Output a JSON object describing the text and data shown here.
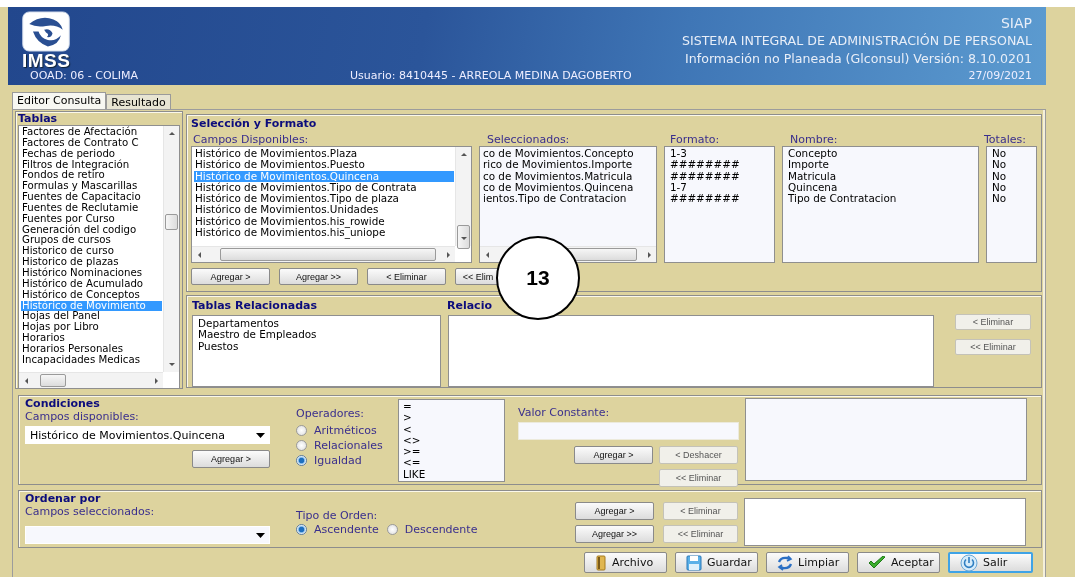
{
  "header": {
    "logo_text": "IMSS",
    "ooad": "OOAD: 06 - COLIMA",
    "user": "Usuario:  8410445 - ARREOLA MEDINA DAGOBERTO",
    "app": "SIAP",
    "system": "SISTEMA INTEGRAL DE ADMINISTRACIÓN DE PERSONAL",
    "info": "Información no Planeada (Glconsul) Versión: 8.10.0201",
    "date": "27/09/2021"
  },
  "tabs": [
    {
      "label": "Editor Consulta",
      "selected": true
    },
    {
      "label": "Resultado",
      "selected": false
    }
  ],
  "tablas": {
    "title": "Tablas",
    "items": [
      {
        "label": "Factores de Afectación",
        "selected": false
      },
      {
        "label": "Factores de Contrato C",
        "selected": false
      },
      {
        "label": "Fechas de periodo",
        "selected": false
      },
      {
        "label": "Filtros de Integración",
        "selected": false
      },
      {
        "label": "Fondos de retiro",
        "selected": false
      },
      {
        "label": "Formulas y Mascarillas",
        "selected": false
      },
      {
        "label": "Fuentes de Capacitacio",
        "selected": false
      },
      {
        "label": "Fuentes de Reclutamie",
        "selected": false
      },
      {
        "label": "Fuentes por Curso",
        "selected": false
      },
      {
        "label": "Generación del codigo",
        "selected": false
      },
      {
        "label": "Grupos de cursos",
        "selected": false
      },
      {
        "label": "Historico de curso",
        "selected": false
      },
      {
        "label": "Historico de plazas",
        "selected": false
      },
      {
        "label": "Histórico Nominaciones",
        "selected": false
      },
      {
        "label": "Histórico de Acumulado",
        "selected": false
      },
      {
        "label": "Histórico de Conceptos",
        "selected": false
      },
      {
        "label": "Histórico de Movimiento",
        "selected": true
      },
      {
        "label": "Hojas del Panel",
        "selected": false
      },
      {
        "label": "Hojas por Libro",
        "selected": false
      },
      {
        "label": "Horarios",
        "selected": false
      },
      {
        "label": "Horarios Personales",
        "selected": false
      },
      {
        "label": "Incapacidades Medicas",
        "selected": false
      }
    ]
  },
  "seleccion": {
    "title": "Selección y Formato",
    "campos": {
      "label": "Campos Disponibles:",
      "items": [
        {
          "label": "Histórico de Movimientos.Plaza",
          "selected": false
        },
        {
          "label": "Histórico de Movimientos.Puesto",
          "selected": false
        },
        {
          "label": "Histórico de Movimientos.Quincena",
          "selected": true
        },
        {
          "label": "Histórico de Movimientos.Tipo de Contrata",
          "selected": false
        },
        {
          "label": "Histórico de Movimientos.Tipo de plaza",
          "selected": false
        },
        {
          "label": "Histórico de Movimientos.Unidades",
          "selected": false
        },
        {
          "label": "Histórico de Movimientos.his_rowide",
          "selected": false
        },
        {
          "label": "Histórico de Movimientos.his_uniope",
          "selected": false
        }
      ]
    },
    "seleccionados": {
      "label": "Seleccionados:",
      "items": [
        "co de Movimientos.Concepto",
        "rico de Movimientos.Importe",
        "co de Movimientos.Matricula",
        "co de Movimientos.Quincena",
        "ientos.Tipo de Contratacion"
      ]
    },
    "formato": {
      "label": "Formato:",
      "items": [
        "1-3",
        "########",
        "########",
        "1-7",
        "########"
      ]
    },
    "nombre": {
      "label": "Nombre:",
      "items": [
        "Concepto",
        "Importe",
        "Matricula",
        "Quincena",
        "Tipo de Contratacion"
      ]
    },
    "totales": {
      "label": "Totales:",
      "items": [
        "No",
        "No",
        "No",
        "No",
        "No"
      ]
    },
    "buttons": [
      {
        "label": "Agregar >",
        "disabled": false
      },
      {
        "label": "Agregar >>",
        "disabled": false
      },
      {
        "label": "< Eliminar",
        "disabled": false
      },
      {
        "label": "<< Elim",
        "disabled": false
      }
    ]
  },
  "relacionadas": {
    "title": "Tablas Relacionadas",
    "items": [
      "Departamentos",
      "Maestro de Empleados",
      "Puestos"
    ],
    "relaciones_title": "Relacio",
    "buttons": [
      {
        "label": "< Eliminar",
        "disabled": true
      },
      {
        "label": "<< Eliminar",
        "disabled": true
      }
    ]
  },
  "condiciones": {
    "title": "Condiciones",
    "campos_label": "Campos disponibles:",
    "campo_value": "Histórico de Movimientos.Quincena",
    "add_button": {
      "label": "Agregar >",
      "disabled": false
    },
    "operadores_label": "Operadores:",
    "operadores": [
      {
        "label": "Aritméticos",
        "selected": false
      },
      {
        "label": "Relacionales",
        "selected": false
      },
      {
        "label": "Igualdad",
        "selected": true
      }
    ],
    "operator_list": [
      "=",
      ">",
      "<",
      "<>",
      ">=",
      "<=",
      "LIKE"
    ],
    "valor_label": "Valor Constante:",
    "buttons": [
      {
        "label": "Agregar >",
        "disabled": false
      },
      {
        "label": "< Deshacer",
        "disabled": true
      },
      {
        "label": "<< Eliminar",
        "disabled": true
      }
    ]
  },
  "ordenar": {
    "title": "Ordenar por",
    "campos_label": "Campos seleccionados:",
    "tipo_label": "Tipo de Orden:",
    "orden": [
      {
        "label": "Ascendente",
        "selected": true
      },
      {
        "label": "Descendente",
        "selected": false
      }
    ],
    "buttons": [
      {
        "label": "Agregar >",
        "disabled": false
      },
      {
        "label": "Agregar >>",
        "disabled": false
      },
      {
        "label": "< Eliminar",
        "disabled": true
      },
      {
        "label": "<< Eliminar",
        "disabled": true
      }
    ]
  },
  "actions": [
    {
      "label": "Archivo",
      "focused": false
    },
    {
      "label": "Guardar",
      "focused": false
    },
    {
      "label": "Limpiar",
      "focused": false
    },
    {
      "label": "Aceptar",
      "focused": false
    },
    {
      "label": "Salir",
      "focused": true
    }
  ],
  "callout": "13"
}
